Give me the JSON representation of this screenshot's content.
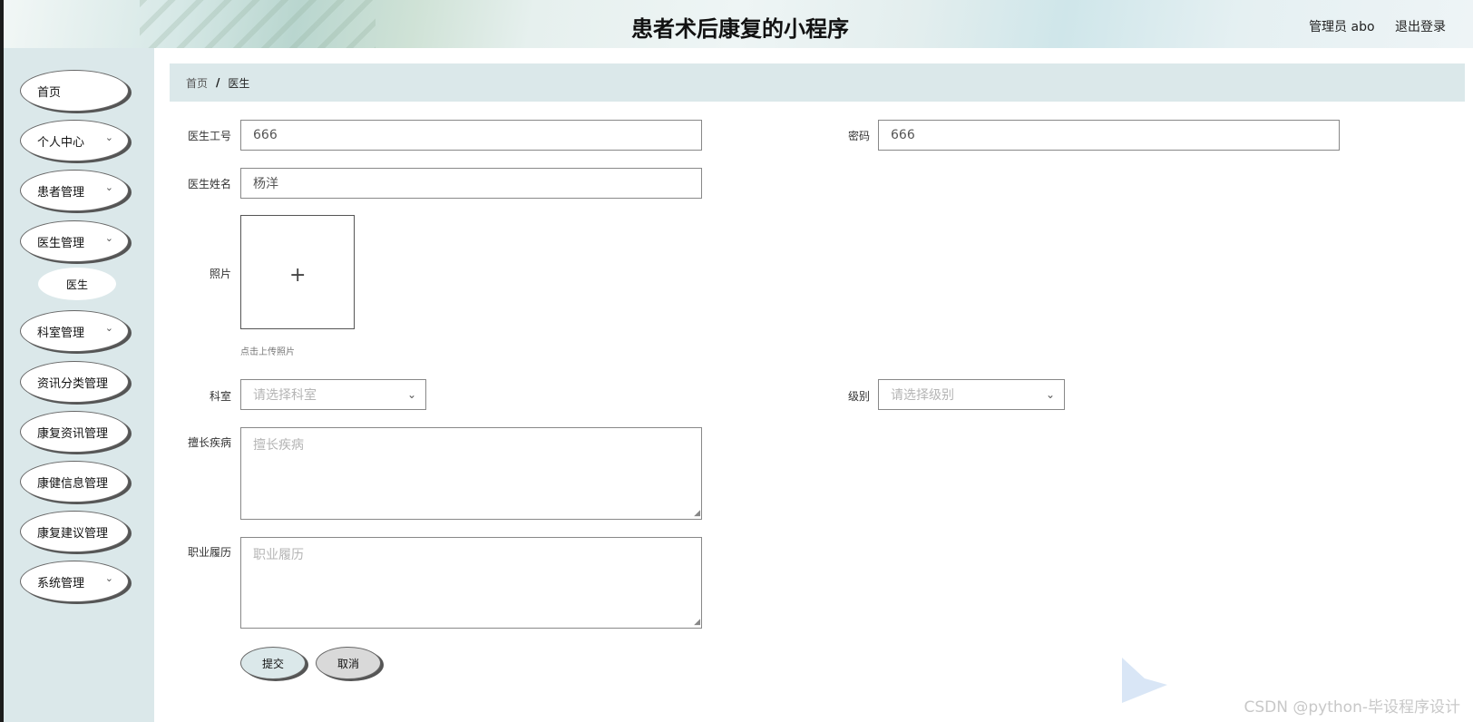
{
  "header": {
    "title": "患者术后康复的小程序",
    "user": "管理员 abo",
    "logout": "退出登录"
  },
  "sidebar": {
    "items": [
      {
        "label": "首页"
      },
      {
        "label": "个人中心"
      },
      {
        "label": "患者管理"
      },
      {
        "label": "医生管理",
        "sub": "医生"
      },
      {
        "label": "科室管理"
      },
      {
        "label": "资讯分类管理"
      },
      {
        "label": "康复资讯管理"
      },
      {
        "label": "康健信息管理"
      },
      {
        "label": "康复建议管理"
      },
      {
        "label": "系统管理"
      }
    ]
  },
  "breadcrumb": {
    "home": "首页",
    "sep": "/",
    "current": "医生"
  },
  "form": {
    "doctor_id": {
      "label": "医生工号",
      "value": "666"
    },
    "password": {
      "label": "密码",
      "value": "666"
    },
    "doctor_name": {
      "label": "医生姓名",
      "value": "杨洋"
    },
    "photo": {
      "label": "照片",
      "hint": "点击上传照片"
    },
    "department": {
      "label": "科室",
      "placeholder": "请选择科室"
    },
    "level": {
      "label": "级别",
      "placeholder": "请选择级别"
    },
    "specialty": {
      "label": "擅长疾病",
      "placeholder": "擅长疾病"
    },
    "resume": {
      "label": "职业履历",
      "placeholder": "职业履历"
    },
    "submit": "提交",
    "cancel": "取消"
  },
  "watermark": "CSDN @python-毕设程序设计",
  "icons": [
    "chevron-down-icon",
    "plus-icon",
    "resize-grip-icon",
    "bilibili-logo-icon"
  ]
}
